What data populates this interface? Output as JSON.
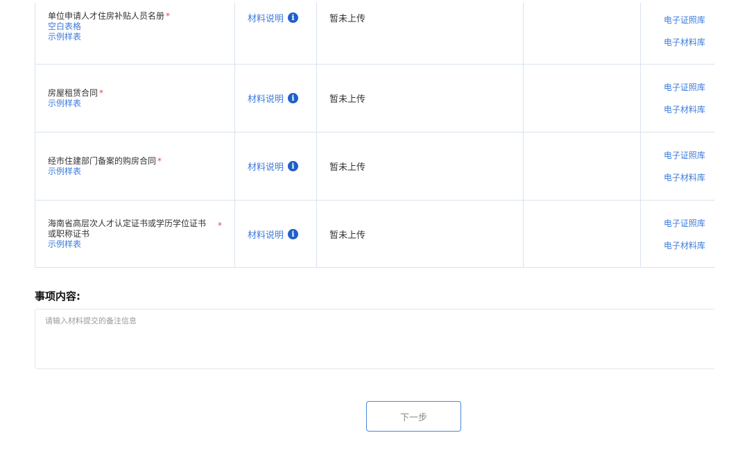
{
  "materials": [
    {
      "name": "单位申请人才住房补贴人员名册",
      "required_mark": "*",
      "links": [
        "空白表格",
        "示例样表"
      ],
      "desc_label": "材料说明",
      "status": "暂未上传",
      "library_links": [
        "电子证照库",
        "电子材料库"
      ]
    },
    {
      "name": "房屋租赁合同",
      "required_mark": "*",
      "links": [
        "示例样表"
      ],
      "desc_label": "材料说明",
      "status": "暂未上传",
      "library_links": [
        "电子证照库",
        "电子材料库"
      ]
    },
    {
      "name": "经市住建部门备案的购房合同",
      "required_mark": "*",
      "links": [
        "示例样表"
      ],
      "desc_label": "材料说明",
      "status": "暂未上传",
      "library_links": [
        "电子证照库",
        "电子材料库"
      ]
    },
    {
      "name": "海南省高层次人才认定证书或学历学位证书或职称证书",
      "required_mark": "*",
      "links": [
        "示例样表"
      ],
      "desc_label": "材料说明",
      "status": "暂未上传",
      "library_links": [
        "电子证照库",
        "电子材料库"
      ]
    }
  ],
  "info_icon_glyph": "i",
  "section": {
    "title": "事项内容:"
  },
  "remark": {
    "placeholder": "请输入材料提交的备注信息",
    "value": ""
  },
  "next_button": {
    "label": "下一步"
  },
  "colors": {
    "link": "#3b7bdb",
    "required": "#e5484d",
    "info_icon": "#1f5fc9",
    "border": "#d9e2ef"
  },
  "icons": {
    "info": "info-circle-icon"
  }
}
